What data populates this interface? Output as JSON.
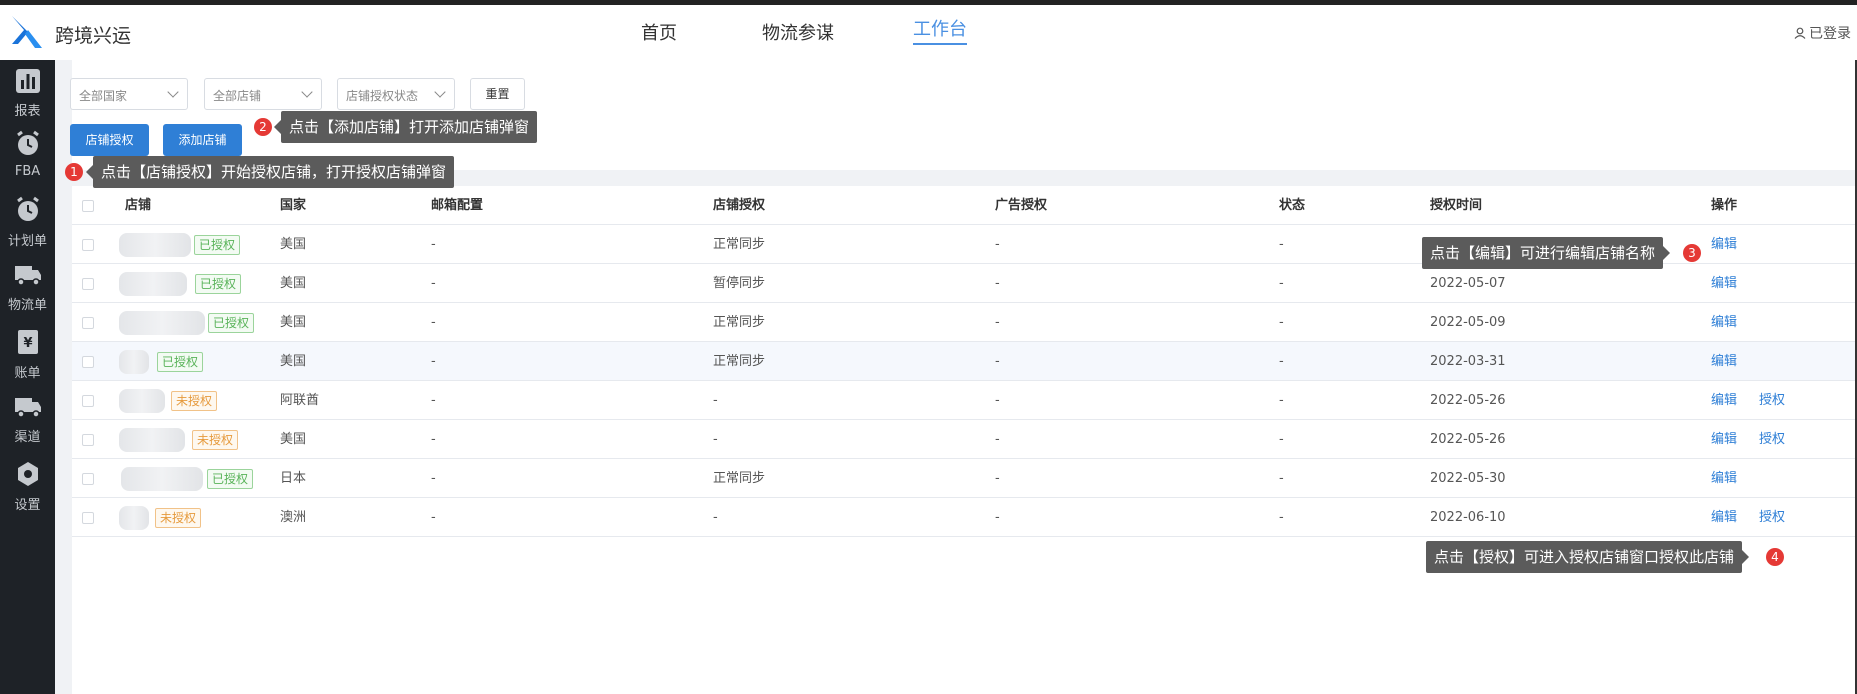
{
  "header": {
    "brand": "跨境兴运",
    "nav": [
      "首页",
      "物流参谋",
      "工作台"
    ],
    "active_nav": "工作台",
    "login": "已登录"
  },
  "sidebar": {
    "items": [
      {
        "label": "报表",
        "icon": "chart-icon"
      },
      {
        "label": "FBA",
        "icon": "alarm-clock-icon"
      },
      {
        "label": "计划单",
        "icon": "alarm-clock-icon"
      },
      {
        "label": "物流单",
        "icon": "truck-icon"
      },
      {
        "label": "账单",
        "icon": "yen-bill-icon"
      },
      {
        "label": "渠道",
        "icon": "truck-icon"
      },
      {
        "label": "设置",
        "icon": "gear-icon"
      }
    ]
  },
  "filters": {
    "country": "全部国家",
    "store": "全部店铺",
    "auth_status": "店铺授权状态",
    "reset": "重置"
  },
  "actions": {
    "authorize": "店铺授权",
    "add": "添加店铺"
  },
  "table": {
    "headers": [
      "店铺",
      "国家",
      "邮箱配置",
      "店铺授权",
      "广告授权",
      "状态",
      "授权时间",
      "操作"
    ],
    "rows": [
      {
        "tag": "已授权",
        "authorized": true,
        "country": "美国",
        "email": "-",
        "store_auth": "正常同步",
        "ad_auth": "-",
        "status": "-",
        "time": "",
        "edit": "编辑",
        "auth": ""
      },
      {
        "tag": "已授权",
        "authorized": true,
        "country": "美国",
        "email": "-",
        "store_auth": "暂停同步",
        "ad_auth": "-",
        "status": "-",
        "time": "2022-05-07",
        "edit": "编辑",
        "auth": ""
      },
      {
        "tag": "已授权",
        "authorized": true,
        "country": "美国",
        "email": "-",
        "store_auth": "正常同步",
        "ad_auth": "-",
        "status": "-",
        "time": "2022-05-09",
        "edit": "编辑",
        "auth": ""
      },
      {
        "tag": "已授权",
        "authorized": true,
        "country": "美国",
        "email": "-",
        "store_auth": "正常同步",
        "ad_auth": "-",
        "status": "-",
        "time": "2022-03-31",
        "edit": "编辑",
        "auth": ""
      },
      {
        "tag": "未授权",
        "authorized": false,
        "country": "阿联酋",
        "email": "-",
        "store_auth": "-",
        "ad_auth": "-",
        "status": "-",
        "time": "2022-05-26",
        "edit": "编辑",
        "auth": "授权"
      },
      {
        "tag": "未授权",
        "authorized": false,
        "country": "美国",
        "email": "-",
        "store_auth": "-",
        "ad_auth": "-",
        "status": "-",
        "time": "2022-05-26",
        "edit": "编辑",
        "auth": "授权"
      },
      {
        "tag": "已授权",
        "authorized": true,
        "country": "日本",
        "email": "-",
        "store_auth": "正常同步",
        "ad_auth": "-",
        "status": "-",
        "time": "2022-05-30",
        "edit": "编辑",
        "auth": ""
      },
      {
        "tag": "未授权",
        "authorized": false,
        "country": "澳洲",
        "email": "-",
        "store_auth": "-",
        "ad_auth": "-",
        "status": "-",
        "time": "2022-06-10",
        "edit": "编辑",
        "auth": "授权"
      }
    ]
  },
  "tips": [
    {
      "num": "1",
      "text": "点击【店铺授权】开始授权店铺，打开授权店铺弹窗"
    },
    {
      "num": "2",
      "text": "点击【添加店铺】打开添加店铺弹窗"
    },
    {
      "num": "3",
      "text": "点击【编辑】可进行编辑店铺名称"
    },
    {
      "num": "4",
      "text": "点击【授权】可进入授权店铺窗口授权此店铺"
    }
  ],
  "colors": {
    "primary": "#2f7fd6",
    "sidebar": "#1e2227",
    "ok": "#59b359",
    "warn": "#e69a3c",
    "badge": "#e53935"
  }
}
